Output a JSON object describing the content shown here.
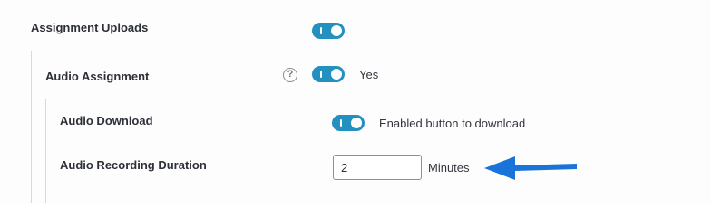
{
  "settings": {
    "assignment_uploads": {
      "label": "Assignment Uploads",
      "toggle_on": true
    },
    "audio_assignment": {
      "label": "Audio Assignment",
      "help_icon": "question-circle-icon",
      "help_glyph": "?",
      "toggle_on": true,
      "status_text": "Yes"
    },
    "audio_download": {
      "label": "Audio Download",
      "toggle_on": true,
      "description": "Enabled button to download"
    },
    "audio_recording_duration": {
      "label": "Audio Recording Duration",
      "value": "2",
      "unit": "Minutes"
    }
  },
  "colors": {
    "toggle_on": "#2390bf",
    "annotation_arrow": "#1a73d9"
  }
}
